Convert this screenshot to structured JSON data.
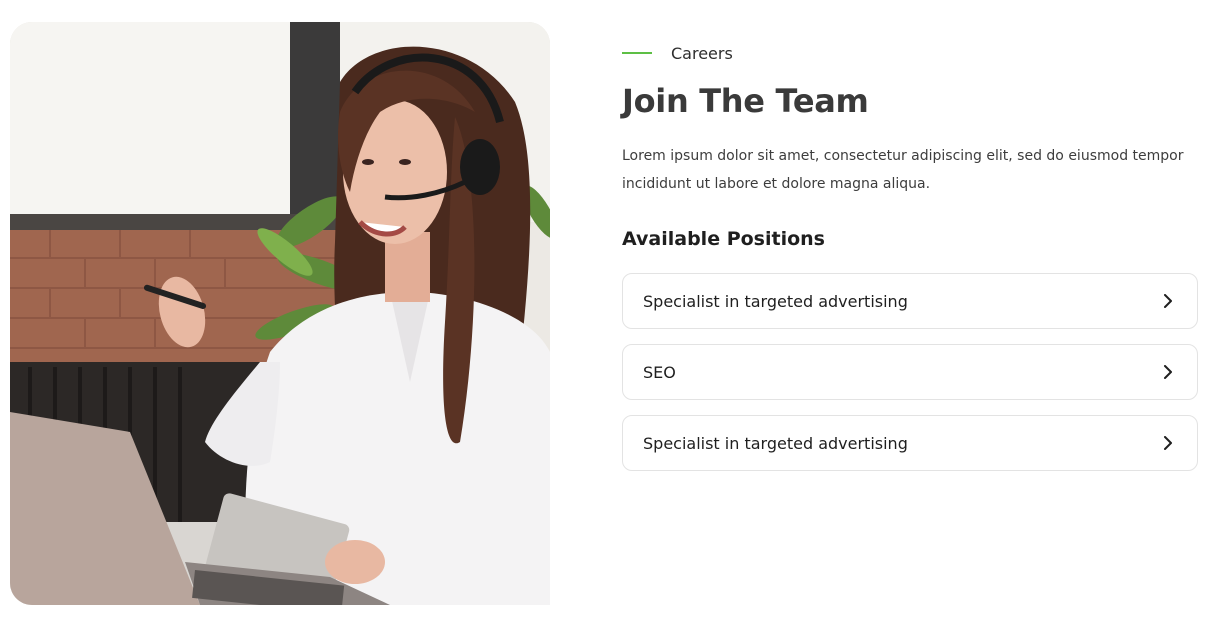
{
  "image": {
    "description_name": "photo"
  },
  "careers": {
    "eyebrow": "Careers",
    "title": "Join The Team",
    "intro": "Lorem ipsum dolor sit amet, consectetur adipiscing elit, sed do eiusmod tempor incididunt ut labore et dolore magna aliqua.",
    "positions_heading": "Available Positions",
    "positions": [
      {
        "label": "Specialist in targeted advertising",
        "icon": "chevron-right-icon"
      },
      {
        "label": "SEO",
        "icon": "chevron-right-icon"
      },
      {
        "label": "Specialist in targeted advertising",
        "icon": "chevron-right-icon"
      }
    ]
  },
  "colors": {
    "accent": "#5dbf45",
    "title": "#3a3a3a",
    "text": "#1f1f1f",
    "border": "#e3e3e3"
  }
}
